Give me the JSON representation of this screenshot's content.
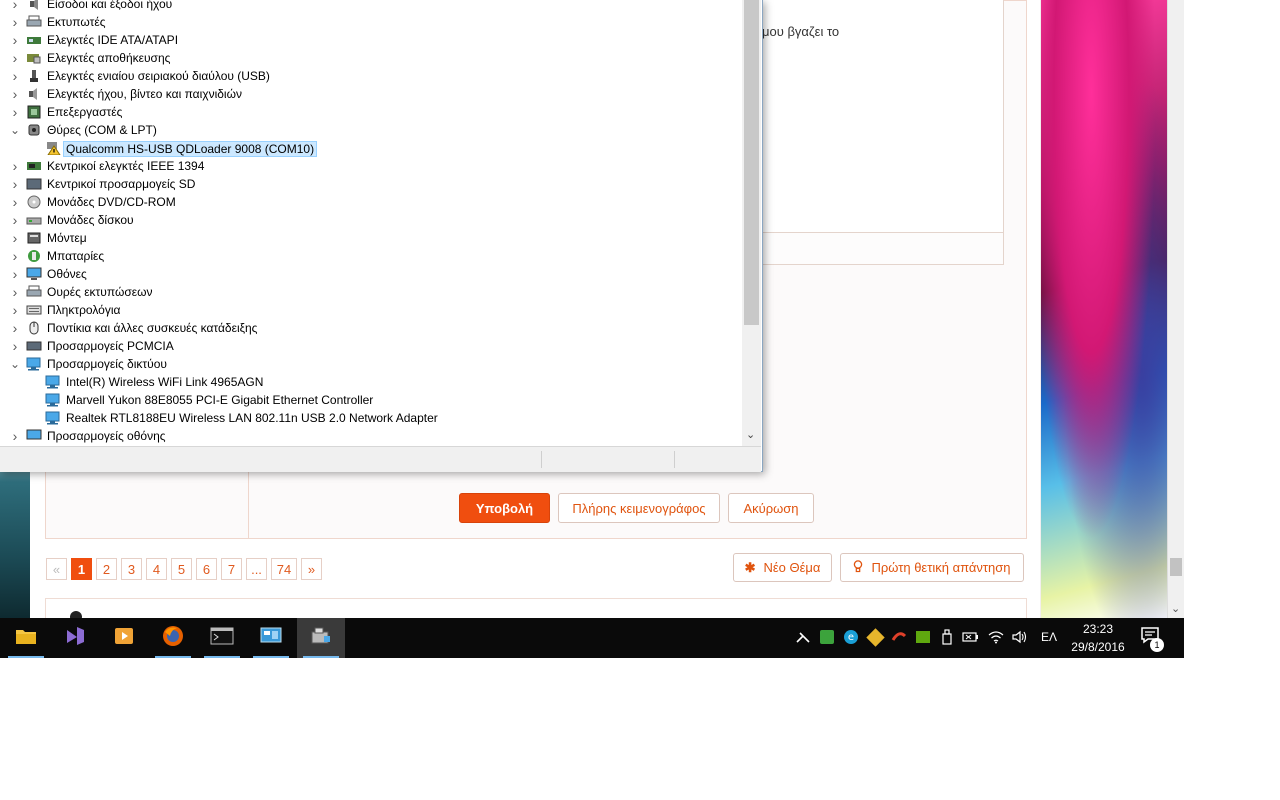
{
  "device_manager": {
    "tree": [
      {
        "label": "Είσοδοι και έξοδοι ήχου",
        "icon": "speaker-icon",
        "expanded": false,
        "level": 0
      },
      {
        "label": "Εκτυπωτές",
        "icon": "printer-icon",
        "expanded": false,
        "level": 0
      },
      {
        "label": "Ελεγκτές IDE ATA/ATAPI",
        "icon": "ide-controller-icon",
        "expanded": false,
        "level": 0
      },
      {
        "label": "Ελεγκτές αποθήκευσης",
        "icon": "storage-controller-icon",
        "expanded": false,
        "level": 0
      },
      {
        "label": "Ελεγκτές ενιαίου σειριακού διαύλου (USB)",
        "icon": "usb-icon",
        "expanded": false,
        "level": 0
      },
      {
        "label": "Ελεγκτές ήχου, βίντεο και παιχνιδιών",
        "icon": "sound-icon",
        "expanded": false,
        "level": 0
      },
      {
        "label": "Επεξεργαστές",
        "icon": "processor-icon",
        "expanded": false,
        "level": 0
      },
      {
        "label": "Θύρες (COM & LPT)",
        "icon": "port-icon",
        "expanded": true,
        "level": 0
      },
      {
        "label": "Qualcomm HS-USB QDLoader 9008 (COM10)",
        "icon": "warning-device-icon",
        "level": 1,
        "selected": true
      },
      {
        "label": "Κεντρικοί ελεγκτές IEEE 1394",
        "icon": "ieee1394-icon",
        "expanded": false,
        "level": 0
      },
      {
        "label": "Κεντρικοί προσαρμογείς SD",
        "icon": "sd-host-icon",
        "expanded": false,
        "level": 0
      },
      {
        "label": "Μονάδες DVD/CD-ROM",
        "icon": "dvd-icon",
        "expanded": false,
        "level": 0
      },
      {
        "label": "Μονάδες δίσκου",
        "icon": "disk-drive-icon",
        "expanded": false,
        "level": 0
      },
      {
        "label": "Μόντεμ",
        "icon": "modem-icon",
        "expanded": false,
        "level": 0
      },
      {
        "label": "Μπαταρίες",
        "icon": "battery-icon",
        "expanded": false,
        "level": 0
      },
      {
        "label": "Οθόνες",
        "icon": "monitor-icon",
        "expanded": false,
        "level": 0
      },
      {
        "label": "Ουρές εκτυπώσεων",
        "icon": "print-queue-icon",
        "expanded": false,
        "level": 0
      },
      {
        "label": "Πληκτρολόγια",
        "icon": "keyboard-icon",
        "expanded": false,
        "level": 0
      },
      {
        "label": "Ποντίκια και άλλες συσκευές κατάδειξης",
        "icon": "mouse-icon",
        "expanded": false,
        "level": 0
      },
      {
        "label": "Προσαρμογείς PCMCIA",
        "icon": "pcmcia-icon",
        "expanded": false,
        "level": 0
      },
      {
        "label": "Προσαρμογείς δικτύου",
        "icon": "network-adapter-icon",
        "expanded": true,
        "level": 0
      },
      {
        "label": "Intel(R) Wireless WiFi Link 4965AGN",
        "icon": "network-adapter-icon",
        "level": 1
      },
      {
        "label": "Marvell Yukon 88E8055 PCI-E Gigabit Ethernet Controller",
        "icon": "network-adapter-icon",
        "level": 1
      },
      {
        "label": "Realtek RTL8188EU Wireless LAN 802.11n USB 2.0 Network Adapter",
        "icon": "network-adapter-icon",
        "level": 1
      },
      {
        "label": "Προσαρμογείς οθόνης",
        "icon": "display-adapter-icon",
        "expanded": false,
        "level": 0
      }
    ]
  },
  "forum": {
    "reply_text_fragment": "μου βγαζει το",
    "buttons": {
      "submit": "Υποβολή",
      "full_editor": "Πλήρης κειμενογράφος",
      "cancel": "Ακύρωση"
    },
    "pagination": {
      "prev": "«",
      "pages": [
        "1",
        "2",
        "3",
        "4",
        "5",
        "6",
        "7",
        "...",
        "74"
      ],
      "current": "1",
      "next": "»"
    },
    "new_topic": "Νέο Θέμα",
    "first_positive_reply": "Πρώτη θετική απάντηση"
  },
  "taskbar": {
    "apps": [
      {
        "name": "file-explorer-icon",
        "running": true
      },
      {
        "name": "visual-studio-icon",
        "running": false
      },
      {
        "name": "media-player-icon",
        "running": false
      },
      {
        "name": "firefox-icon",
        "running": true
      },
      {
        "name": "command-prompt-icon",
        "running": true
      },
      {
        "name": "control-panel-icon",
        "running": true
      },
      {
        "name": "device-manager-icon",
        "running": true,
        "active": true
      }
    ],
    "language": "ΕΛ",
    "time": "23:23",
    "date": "29/8/2016",
    "notification_count": "1"
  },
  "colors": {
    "accent": "#f04e0f",
    "selection": "#cce8ff",
    "taskbar": "#0a0a0a"
  }
}
